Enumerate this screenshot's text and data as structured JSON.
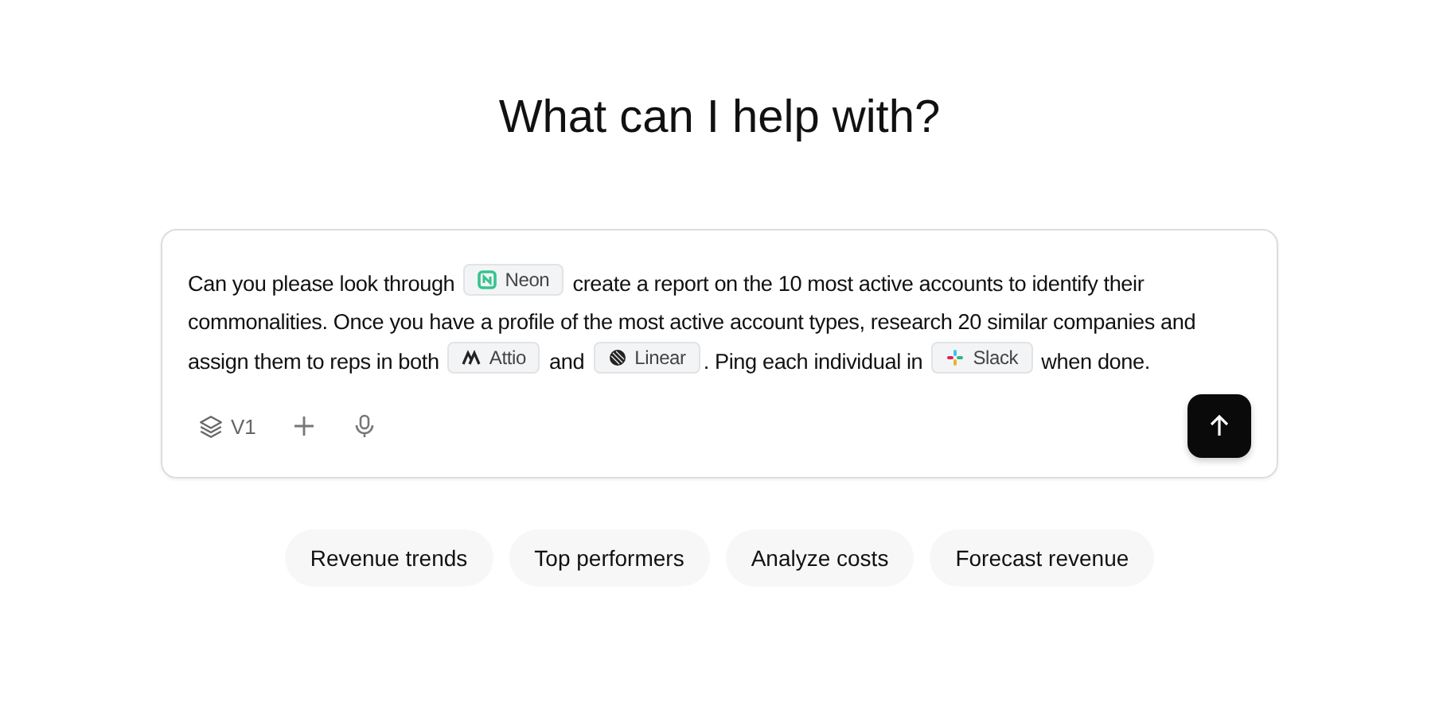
{
  "heading": "What can I help with?",
  "prompt": [
    {
      "kind": "text",
      "text": "Can you please look through "
    },
    {
      "kind": "chip",
      "text": "Neon"
    },
    {
      "kind": "text",
      "text": " create a report on the 10 most active accounts  to identify their commonalities. Once you have a profile of the most active account types, research 20 similar companies and assign them to reps in both "
    },
    {
      "kind": "chip",
      "text": "Attio"
    },
    {
      "kind": "text",
      "text": " and "
    },
    {
      "kind": "chip",
      "text": "Linear"
    },
    {
      "kind": "text",
      "text": ". Ping each individual in "
    },
    {
      "kind": "chip",
      "text": "Slack"
    },
    {
      "kind": "text",
      "text": " when done."
    }
  ],
  "model": "V1",
  "suggestions": [
    "Revenue trends",
    "Top performers",
    "Analyze costs",
    "Forecast revenue"
  ]
}
